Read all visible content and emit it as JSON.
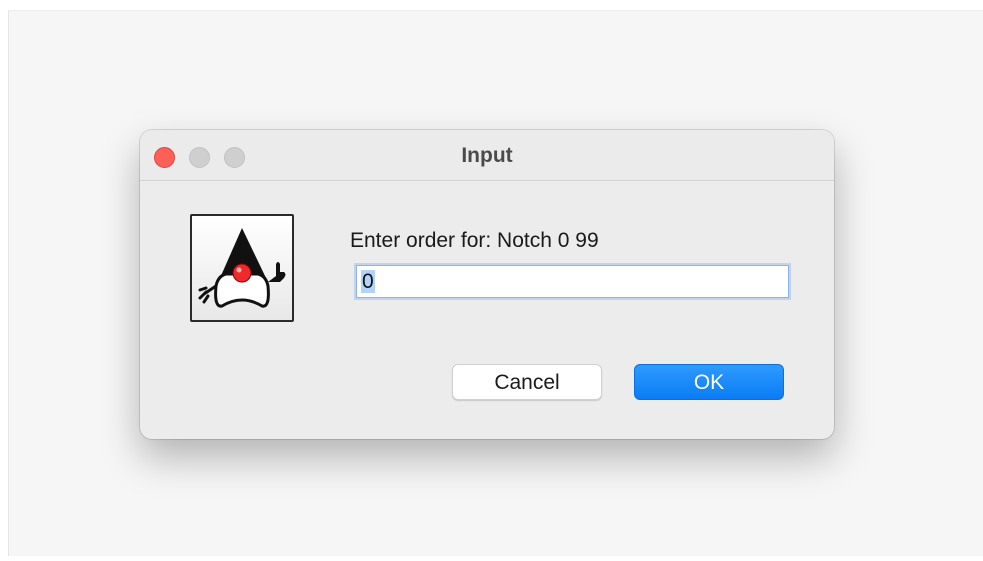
{
  "dialog": {
    "title": "Input",
    "icon": "java-duke-icon",
    "prompt": "Enter order for: Notch 0 99",
    "input": {
      "value": "0",
      "placeholder": ""
    },
    "buttons": {
      "cancel_label": "Cancel",
      "ok_label": "OK"
    }
  },
  "window_controls": [
    "close",
    "minimize",
    "zoom"
  ],
  "colors": {
    "accent": "#0a7cf5",
    "close": "#fe5f57",
    "inactive_control": "#cfcfcf",
    "dialog_bg": "#ececec"
  }
}
